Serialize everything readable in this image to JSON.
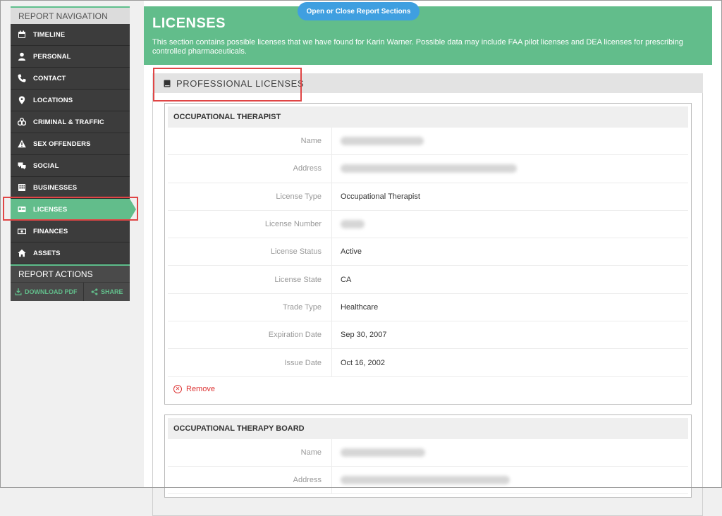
{
  "sidebar": {
    "header": "REPORT NAVIGATION",
    "items": [
      {
        "label": "TIMELINE",
        "icon": "calendar-icon"
      },
      {
        "label": "PERSONAL",
        "icon": "person-icon"
      },
      {
        "label": "CONTACT",
        "icon": "phone-icon"
      },
      {
        "label": "LOCATIONS",
        "icon": "location-pin-icon"
      },
      {
        "label": "CRIMINAL & TRAFFIC",
        "icon": "handcuffs-icon"
      },
      {
        "label": "SEX OFFENDERS",
        "icon": "warning-icon"
      },
      {
        "label": "SOCIAL",
        "icon": "chat-icon"
      },
      {
        "label": "BUSINESSES",
        "icon": "building-icon"
      },
      {
        "label": "LICENSES",
        "icon": "id-card-icon",
        "active": true
      },
      {
        "label": "FINANCES",
        "icon": "money-icon"
      },
      {
        "label": "ASSETS",
        "icon": "home-icon"
      }
    ],
    "actions_header": "REPORT ACTIONS",
    "download_label": "DOWNLOAD PDF",
    "share_label": "SHARE"
  },
  "main": {
    "toggle_label": "Open or Close Report Sections",
    "title": "LICENSES",
    "description": "This section contains possible licenses that we have found for Karin Warner. Possible data may include FAA pilot licenses and DEA licenses for prescribing controlled pharmaceuticals.",
    "section_title": "PROFESSIONAL LICENSES",
    "cards": [
      {
        "title": "OCCUPATIONAL THERAPIST",
        "fields": [
          {
            "label": "Name",
            "value": ""
          },
          {
            "label": "Address",
            "value": ""
          },
          {
            "label": "License Type",
            "value": "Occupational Therapist"
          },
          {
            "label": "License Number",
            "value": ""
          },
          {
            "label": "License Status",
            "value": "Active"
          },
          {
            "label": "License State",
            "value": "CA"
          },
          {
            "label": "Trade Type",
            "value": "Healthcare"
          },
          {
            "label": "Expiration Date",
            "value": "Sep 30, 2007"
          },
          {
            "label": "Issue Date",
            "value": "Oct 16, 2002"
          }
        ],
        "remove_label": "Remove"
      },
      {
        "title": "OCCUPATIONAL THERAPY BOARD",
        "fields": [
          {
            "label": "Name",
            "value": ""
          },
          {
            "label": "Address",
            "value": ""
          }
        ]
      }
    ]
  },
  "colors": {
    "accent_green": "#62bd8b",
    "nav_dark": "#3c3c3c",
    "toggle_blue": "#3f9fe0",
    "highlight_red": "#e04545"
  }
}
